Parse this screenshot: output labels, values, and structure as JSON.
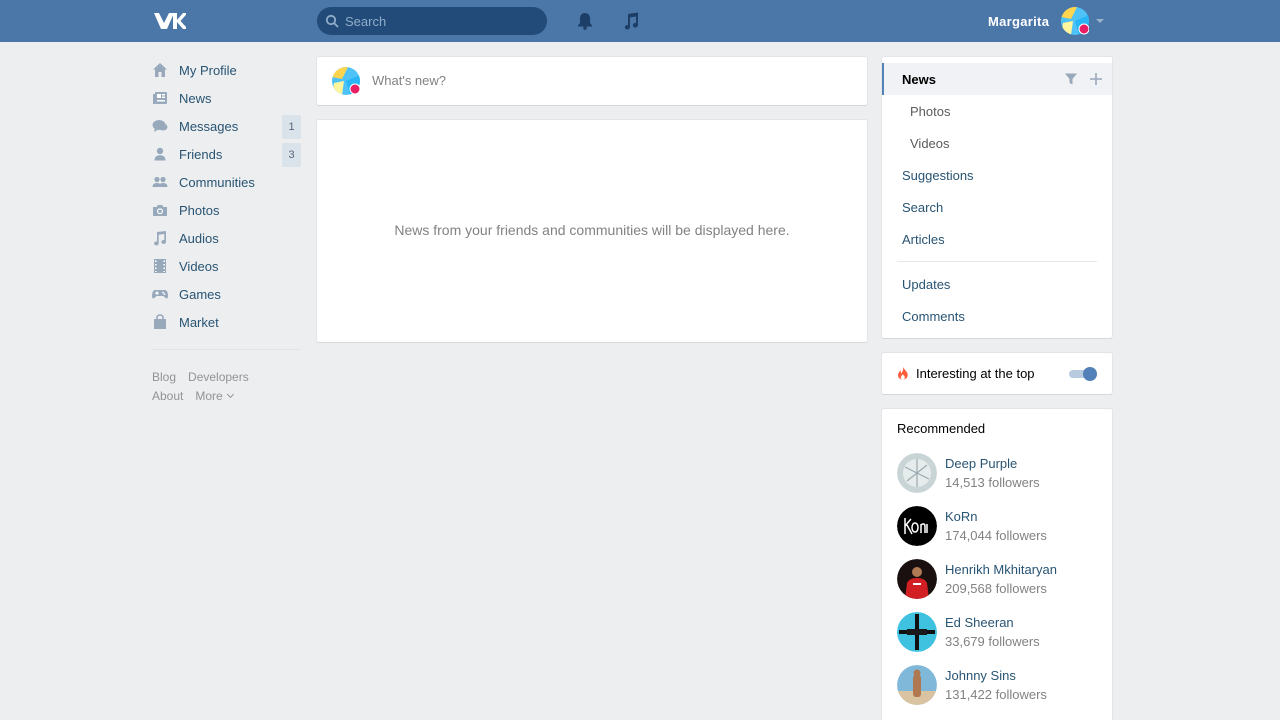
{
  "colors": {
    "header_bg": "#4a76a8",
    "page_bg": "#edeef0",
    "link": "#285473",
    "accent": "#5181b8",
    "muted": "#828282"
  },
  "header": {
    "logo_icon": "vk-logo-icon",
    "search_placeholder": "Search",
    "notifications_icon": "bell-icon",
    "music_icon": "music-note-icon",
    "user_name": "Margarita"
  },
  "sidebar": {
    "items": [
      {
        "label": "My Profile",
        "icon": "home-icon"
      },
      {
        "label": "News",
        "icon": "news-icon"
      },
      {
        "label": "Messages",
        "icon": "messages-icon",
        "count": "1"
      },
      {
        "label": "Friends",
        "icon": "person-icon",
        "count": "3"
      },
      {
        "label": "Communities",
        "icon": "group-icon"
      },
      {
        "label": "Photos",
        "icon": "camera-icon"
      },
      {
        "label": "Audios",
        "icon": "music-note-icon"
      },
      {
        "label": "Videos",
        "icon": "film-icon"
      },
      {
        "label": "Games",
        "icon": "gamepad-icon"
      },
      {
        "label": "Market",
        "icon": "bag-icon"
      }
    ],
    "footer": {
      "blog": "Blog",
      "developers": "Developers",
      "about": "About",
      "more": "More"
    }
  },
  "composer": {
    "placeholder": "What's new?"
  },
  "feed": {
    "empty_text": "News from your friends and communities will be displayed here."
  },
  "right_menu": {
    "items": [
      {
        "label": "News",
        "active": true
      },
      {
        "label": "Photos",
        "sub": true
      },
      {
        "label": "Videos",
        "sub": true
      },
      {
        "label": "Suggestions"
      },
      {
        "label": "Search"
      },
      {
        "label": "Articles"
      },
      {
        "label": "Updates"
      },
      {
        "label": "Comments"
      }
    ]
  },
  "interesting": {
    "label": "Interesting at the top",
    "enabled": true
  },
  "recommended": {
    "title": "Recommended",
    "items": [
      {
        "name": "Deep Purple",
        "followers": "14,513 followers"
      },
      {
        "name": "KoRn",
        "followers": "174,044 followers"
      },
      {
        "name": "Henrikh Mkhitaryan",
        "followers": "209,568 followers"
      },
      {
        "name": "Ed Sheeran",
        "followers": "33,679 followers"
      },
      {
        "name": "Johnny Sins",
        "followers": "131,422 followers"
      }
    ]
  }
}
